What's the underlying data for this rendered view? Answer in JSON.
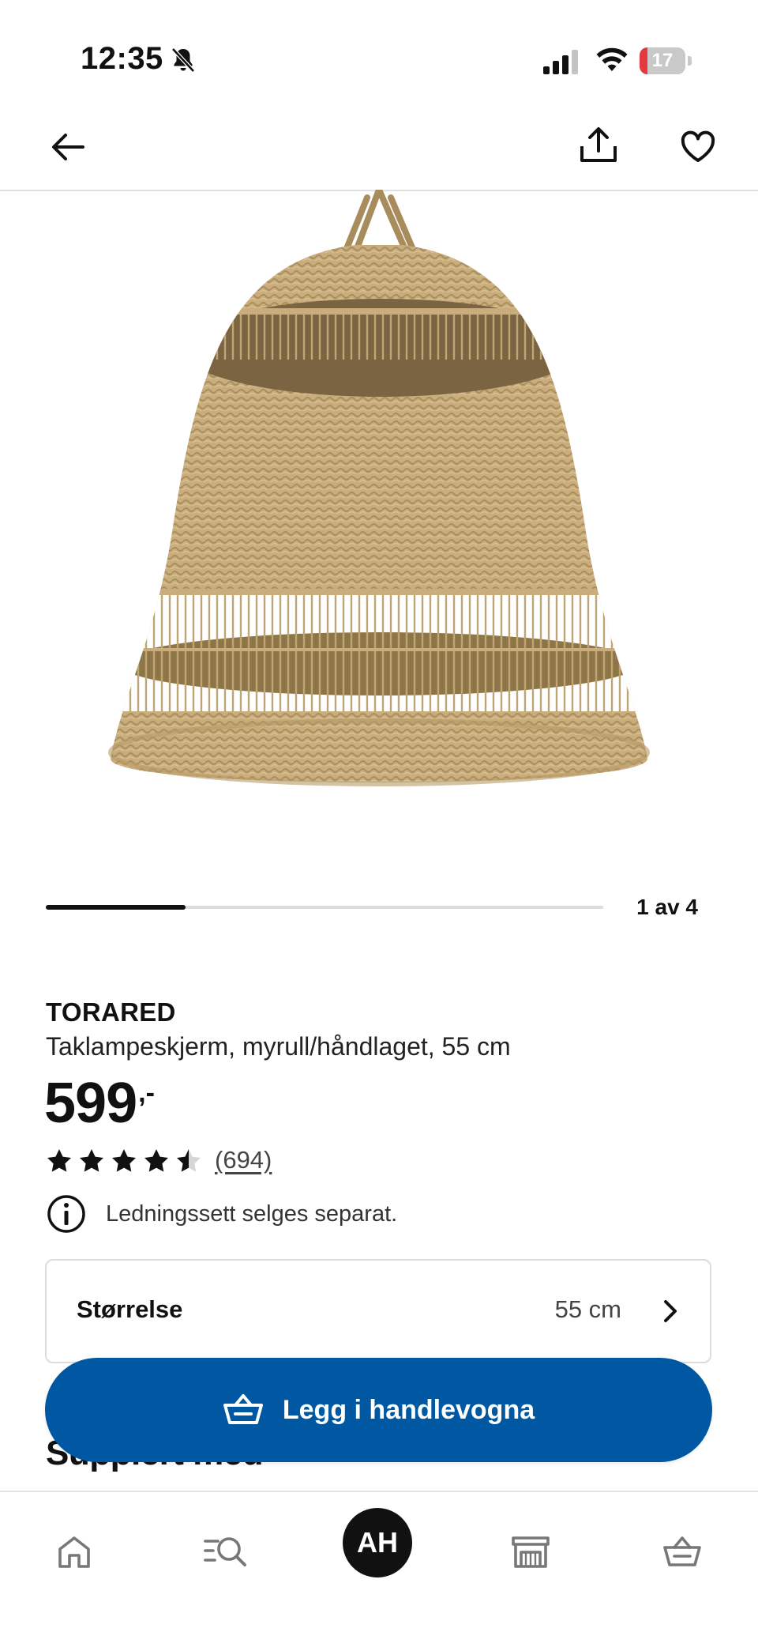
{
  "status_bar": {
    "time": "12:35",
    "battery_level": "17",
    "battery_fraction": 0.17,
    "battery_color": "#e5393f"
  },
  "product": {
    "name": "TORARED",
    "description": "Taklampeskjerm, myrull/håndlaget, 55 cm",
    "price": "599",
    "price_suffix": ",-",
    "rating": 4.5,
    "rating_max": 5,
    "review_count": "(694)",
    "notice": "Ledningssett selges separat."
  },
  "gallery": {
    "label": "1 av 4",
    "current": 1,
    "total": 4,
    "progress_fraction": 0.25
  },
  "size_selector": {
    "label": "Størrelse",
    "value": "55 cm"
  },
  "section": {
    "heading": "Supplert med"
  },
  "cart_button": {
    "label": "Legg i handlevogna",
    "color": "#0058a3"
  },
  "tabbar": {
    "profile_initials": "AH",
    "items": [
      "home-icon",
      "search-list-icon",
      "profile-avatar",
      "store-icon",
      "cart-icon"
    ]
  }
}
